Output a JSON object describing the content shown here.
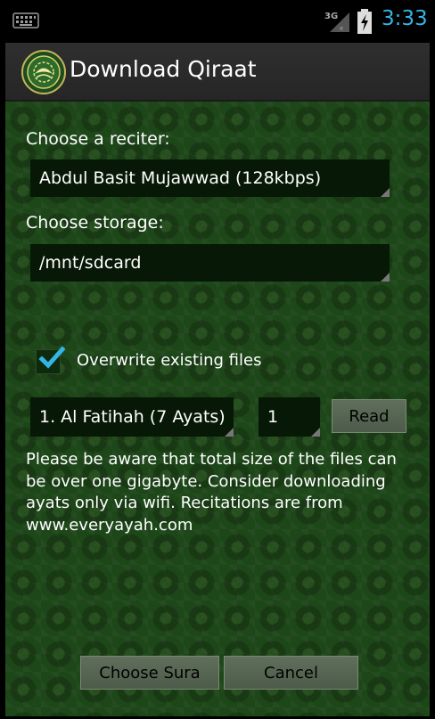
{
  "status_bar": {
    "network": "3G",
    "time": "3:33",
    "icons": [
      "keyboard-icon",
      "signal-3g-icon",
      "battery-charging-icon"
    ]
  },
  "app": {
    "title": "Download Qiraat",
    "icon": "quran-app-icon"
  },
  "form": {
    "reciter_label": "Choose a reciter:",
    "reciter_value": "Abdul Basit Mujawwad (128kbps)",
    "storage_label": "Choose storage:",
    "storage_value": "/mnt/sdcard",
    "overwrite_label": "Overwrite existing files",
    "overwrite_checked": true,
    "sura_value": "1. Al Fatihah (7 Ayats)",
    "ayat_value": "1",
    "read_button": "Read",
    "info_text": "Please be aware that total size of the files can be over one gigabyte. Consider downloading ayats only via wifi. Recitations are from www.everyayah.com"
  },
  "buttons": {
    "choose_sura": "Choose Sura",
    "cancel": "Cancel"
  },
  "colors": {
    "clock": "#33b5e5",
    "background": "#1d4619",
    "check": "#33b5e5"
  }
}
